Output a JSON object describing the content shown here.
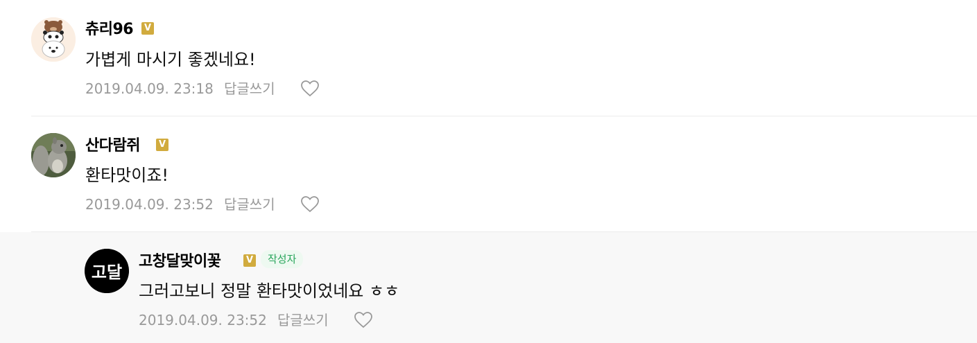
{
  "comments": [
    {
      "author": "츄리96",
      "verified_label": "V",
      "text": "가볍게 마시기 좋겠네요!",
      "timestamp": "2019.04.09. 23:18",
      "reply_label": "답글쓰기",
      "avatar_icon": "bear-stack-avatar",
      "like_icon": "heart-outline-icon"
    },
    {
      "author": "산다람쥐",
      "verified_label": "V",
      "text": "환타맛이죠!",
      "timestamp": "2019.04.09. 23:52",
      "reply_label": "답글쓰기",
      "avatar_icon": "squirrel-avatar",
      "like_icon": "heart-outline-icon"
    },
    {
      "author": "고창달맞이꽃",
      "verified_label": "V",
      "author_badge": "작성자",
      "avatar_logo_text": "고달",
      "text": "그러고보니 정말 환타맛이었네요 ㅎㅎ",
      "timestamp": "2019.04.09. 23:52",
      "reply_label": "답글쓰기",
      "avatar_icon": "logo-avatar",
      "like_icon": "heart-outline-icon"
    }
  ],
  "colors": {
    "verified_badge": "#d1ab3e",
    "author_badge_text": "#27a55a",
    "meta_text": "#999999",
    "reply_background": "#f8f8f8"
  }
}
